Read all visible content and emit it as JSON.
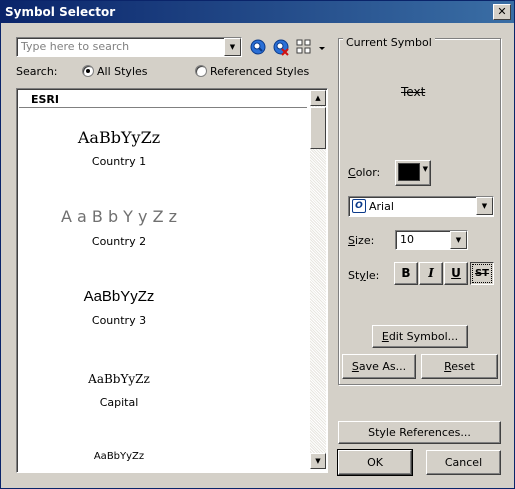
{
  "window": {
    "title": "Symbol Selector",
    "close_glyph": "✕"
  },
  "search": {
    "placeholder": "Type here to search",
    "label": "Search:",
    "options": [
      "All Styles",
      "Referenced Styles"
    ],
    "selected": "All Styles"
  },
  "list": {
    "header": "ESRI",
    "items": [
      {
        "preview": "AaBbYyZz",
        "name": "Country 1"
      },
      {
        "preview": "A a B b Y y Z z",
        "name": "Country 2"
      },
      {
        "preview": "AaBbYyZz",
        "name": "Country 3"
      },
      {
        "preview": "AaBbYyZz",
        "name": "Capital"
      },
      {
        "preview": "AaBbYyZz",
        "name": ""
      }
    ]
  },
  "current_symbol": {
    "legend": "Current Symbol",
    "preview_text": "Text",
    "color_label": "Color:",
    "color": "#000000",
    "font": "Arial",
    "size_label": "Size:",
    "size": "10",
    "style_label": "Style:",
    "style_buttons": [
      "B",
      "I",
      "U",
      "ST"
    ],
    "edit_button": "Edit Symbol...",
    "save_as_button": "Save As...",
    "reset_button": "Reset"
  },
  "footer": {
    "style_references_button": "Style References...",
    "ok_button": "OK",
    "cancel_button": "Cancel"
  }
}
